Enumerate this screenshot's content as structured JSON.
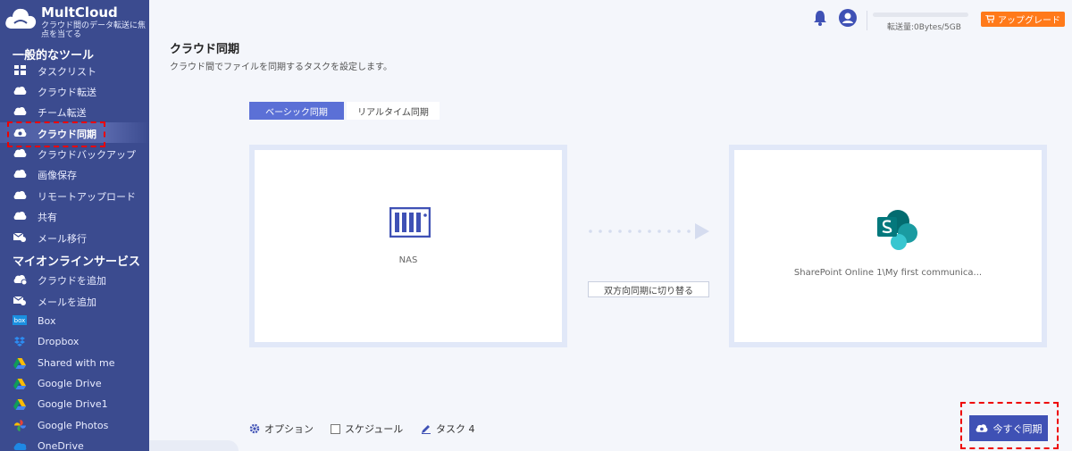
{
  "brand": {
    "name": "MultCloud",
    "tagline": "クラウド間のデータ転送に焦点を当てる"
  },
  "sidebar": {
    "section_general": "一般的なツール",
    "general_items": [
      {
        "label": "タスクリスト",
        "icon": "grid-icon"
      },
      {
        "label": "クラウド転送",
        "icon": "cloud-transfer-icon"
      },
      {
        "label": "チーム転送",
        "icon": "team-transfer-icon"
      },
      {
        "label": "クラウド同期",
        "icon": "cloud-sync-icon"
      },
      {
        "label": "クラウドバックアップ",
        "icon": "cloud-backup-icon"
      },
      {
        "label": "画像保存",
        "icon": "image-save-icon"
      },
      {
        "label": "リモートアップロード",
        "icon": "remote-upload-icon"
      },
      {
        "label": "共有",
        "icon": "share-icon"
      },
      {
        "label": "メール移行",
        "icon": "email-migration-icon"
      }
    ],
    "section_online": "マイオンラインサービス",
    "online_items": [
      {
        "label": "クラウドを追加",
        "icon": "add-cloud-icon"
      },
      {
        "label": "メールを追加",
        "icon": "add-email-icon"
      },
      {
        "label": "Box",
        "icon": "box-icon"
      },
      {
        "label": "Dropbox",
        "icon": "dropbox-icon"
      },
      {
        "label": "Shared with me",
        "icon": "google-drive-icon"
      },
      {
        "label": "Google Drive",
        "icon": "google-drive-icon"
      },
      {
        "label": "Google Drive1",
        "icon": "google-drive-icon"
      },
      {
        "label": "Google Photos",
        "icon": "google-photos-icon"
      },
      {
        "label": "OneDrive",
        "icon": "onedrive-icon"
      }
    ],
    "box_icon_text": "box"
  },
  "topbar": {
    "quota": "転送量:0Bytes/5GB",
    "upgrade": "アップグレード"
  },
  "main": {
    "title": "クラウド同期",
    "subtitle": "クラウド間でファイルを同期するタスクを設定します。",
    "tabs": [
      "ベーシック同期",
      "リアルタイム同期"
    ],
    "source_label": "NAS",
    "target_label": "SharePoint Online 1\\My first communica...",
    "switch_button": "双方向同期に切り替る",
    "options": "オプション",
    "schedule": "スケジュール",
    "task": "タスク 4",
    "sync_now": "今すぐ同期",
    "colors": {
      "accent": "#3f51b5",
      "upgrade": "#ff7a1a",
      "sidebar": "#3b4b8f",
      "highlight": "#e00000"
    }
  }
}
